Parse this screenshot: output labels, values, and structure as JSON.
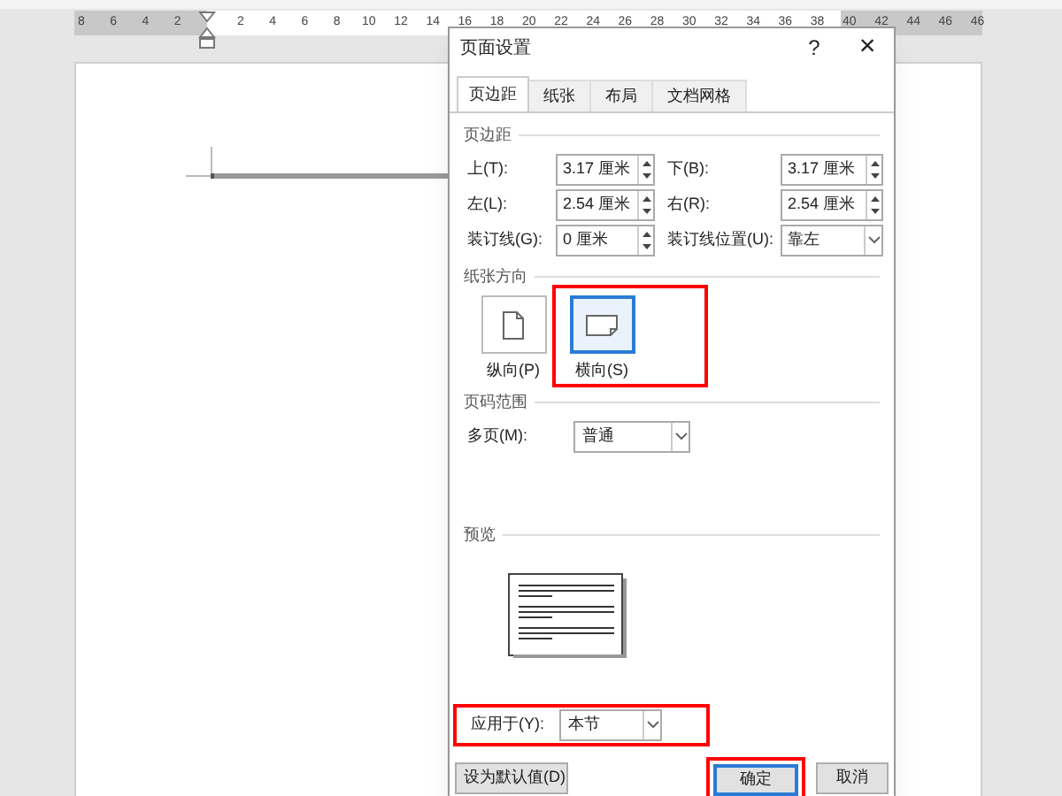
{
  "ruler": {
    "ticks": [
      "8",
      "6",
      "4",
      "2",
      "2",
      "4",
      "6",
      "8",
      "10",
      "12",
      "14",
      "16",
      "18",
      "20",
      "22",
      "24",
      "26",
      "28",
      "30",
      "32",
      "34",
      "36",
      "38",
      "40",
      "42",
      "44",
      "46",
      "46"
    ]
  },
  "dialog": {
    "title": "页面设置",
    "help": "?",
    "close": "×"
  },
  "tabs": [
    {
      "label": "页边距",
      "selected": true
    },
    {
      "label": "纸张",
      "selected": false
    },
    {
      "label": "布局",
      "selected": false
    },
    {
      "label": "文档网格",
      "selected": false
    }
  ],
  "margins": {
    "heading": "页边距",
    "fields": [
      {
        "label": "上(T):",
        "value": "3.17 厘米",
        "kind": "spin"
      },
      {
        "label": "下(B):",
        "value": "3.17 厘米",
        "kind": "spin"
      },
      {
        "label": "左(L):",
        "value": "2.54 厘米",
        "kind": "spin"
      },
      {
        "label": "右(R):",
        "value": "2.54 厘米",
        "kind": "spin"
      },
      {
        "label": "装订线(G):",
        "value": "0 厘米",
        "kind": "spin"
      },
      {
        "label": "装订线位置(U):",
        "value": "靠左",
        "kind": "select"
      }
    ]
  },
  "orientation": {
    "heading": "纸张方向",
    "options": [
      {
        "label": "纵向(P)",
        "kind": "portrait",
        "selected": false,
        "highlighted": false
      },
      {
        "label": "横向(S)",
        "kind": "landscape",
        "selected": true,
        "highlighted": true
      }
    ]
  },
  "pages": {
    "heading": "页码范围",
    "label": "多页(M):",
    "value": "普通"
  },
  "preview": {
    "heading": "预览"
  },
  "apply_to": {
    "label": "应用于(Y):",
    "value": "本节",
    "highlighted": true
  },
  "buttons": [
    {
      "label": "设为默认值(D)",
      "highlighted": false,
      "default": false
    },
    {
      "label": "确定",
      "highlighted": true,
      "default": true
    },
    {
      "label": "取消",
      "highlighted": false,
      "default": false
    }
  ]
}
